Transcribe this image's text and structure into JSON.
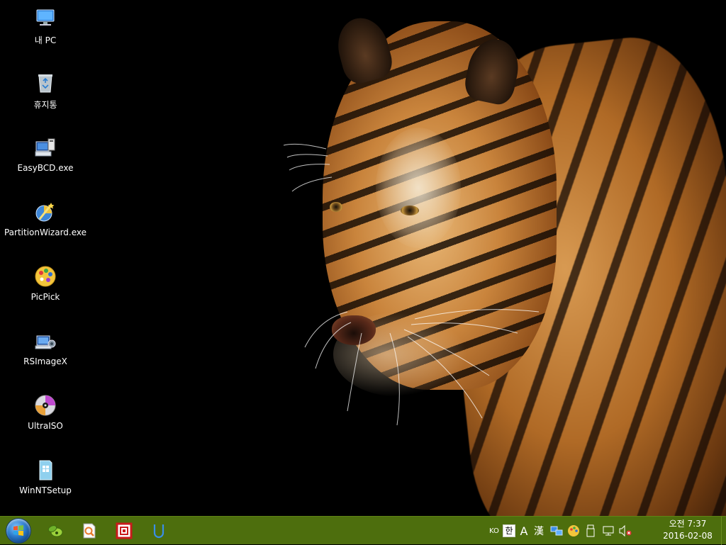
{
  "desktop": {
    "icons": [
      {
        "label": "내 PC",
        "icon": "computer-icon"
      },
      {
        "label": "휴지통",
        "icon": "recycle-bin-icon"
      },
      {
        "label": "EasyBCD.exe",
        "icon": "easybcd-icon"
      },
      {
        "label": "PartitionWizard.exe",
        "icon": "partition-wizard-icon"
      },
      {
        "label": "PicPick",
        "icon": "picpick-icon"
      },
      {
        "label": "RSImageX",
        "icon": "rsimagex-icon"
      },
      {
        "label": "UltraISO",
        "icon": "ultraiso-icon"
      },
      {
        "label": "WinNTSetup",
        "icon": "winntsetup-icon"
      }
    ]
  },
  "taskbar": {
    "color": "#4d6e0d",
    "pinned": [
      "start-orb-icon",
      "green-leaf-app-icon",
      "picpick-editor-icon",
      "red-grid-app-icon",
      "blue-u-app-icon"
    ],
    "tray": {
      "lang": "KO",
      "ime_mode": "한",
      "ime_letter": "A",
      "ime_hanja": "漢",
      "icons": [
        "network-share-icon",
        "picpick-tray-icon",
        "usb-device-icon",
        "network-icon",
        "volume-muted-icon"
      ]
    },
    "clock": {
      "time": "오전 7:37",
      "date": "2016-02-08"
    }
  }
}
